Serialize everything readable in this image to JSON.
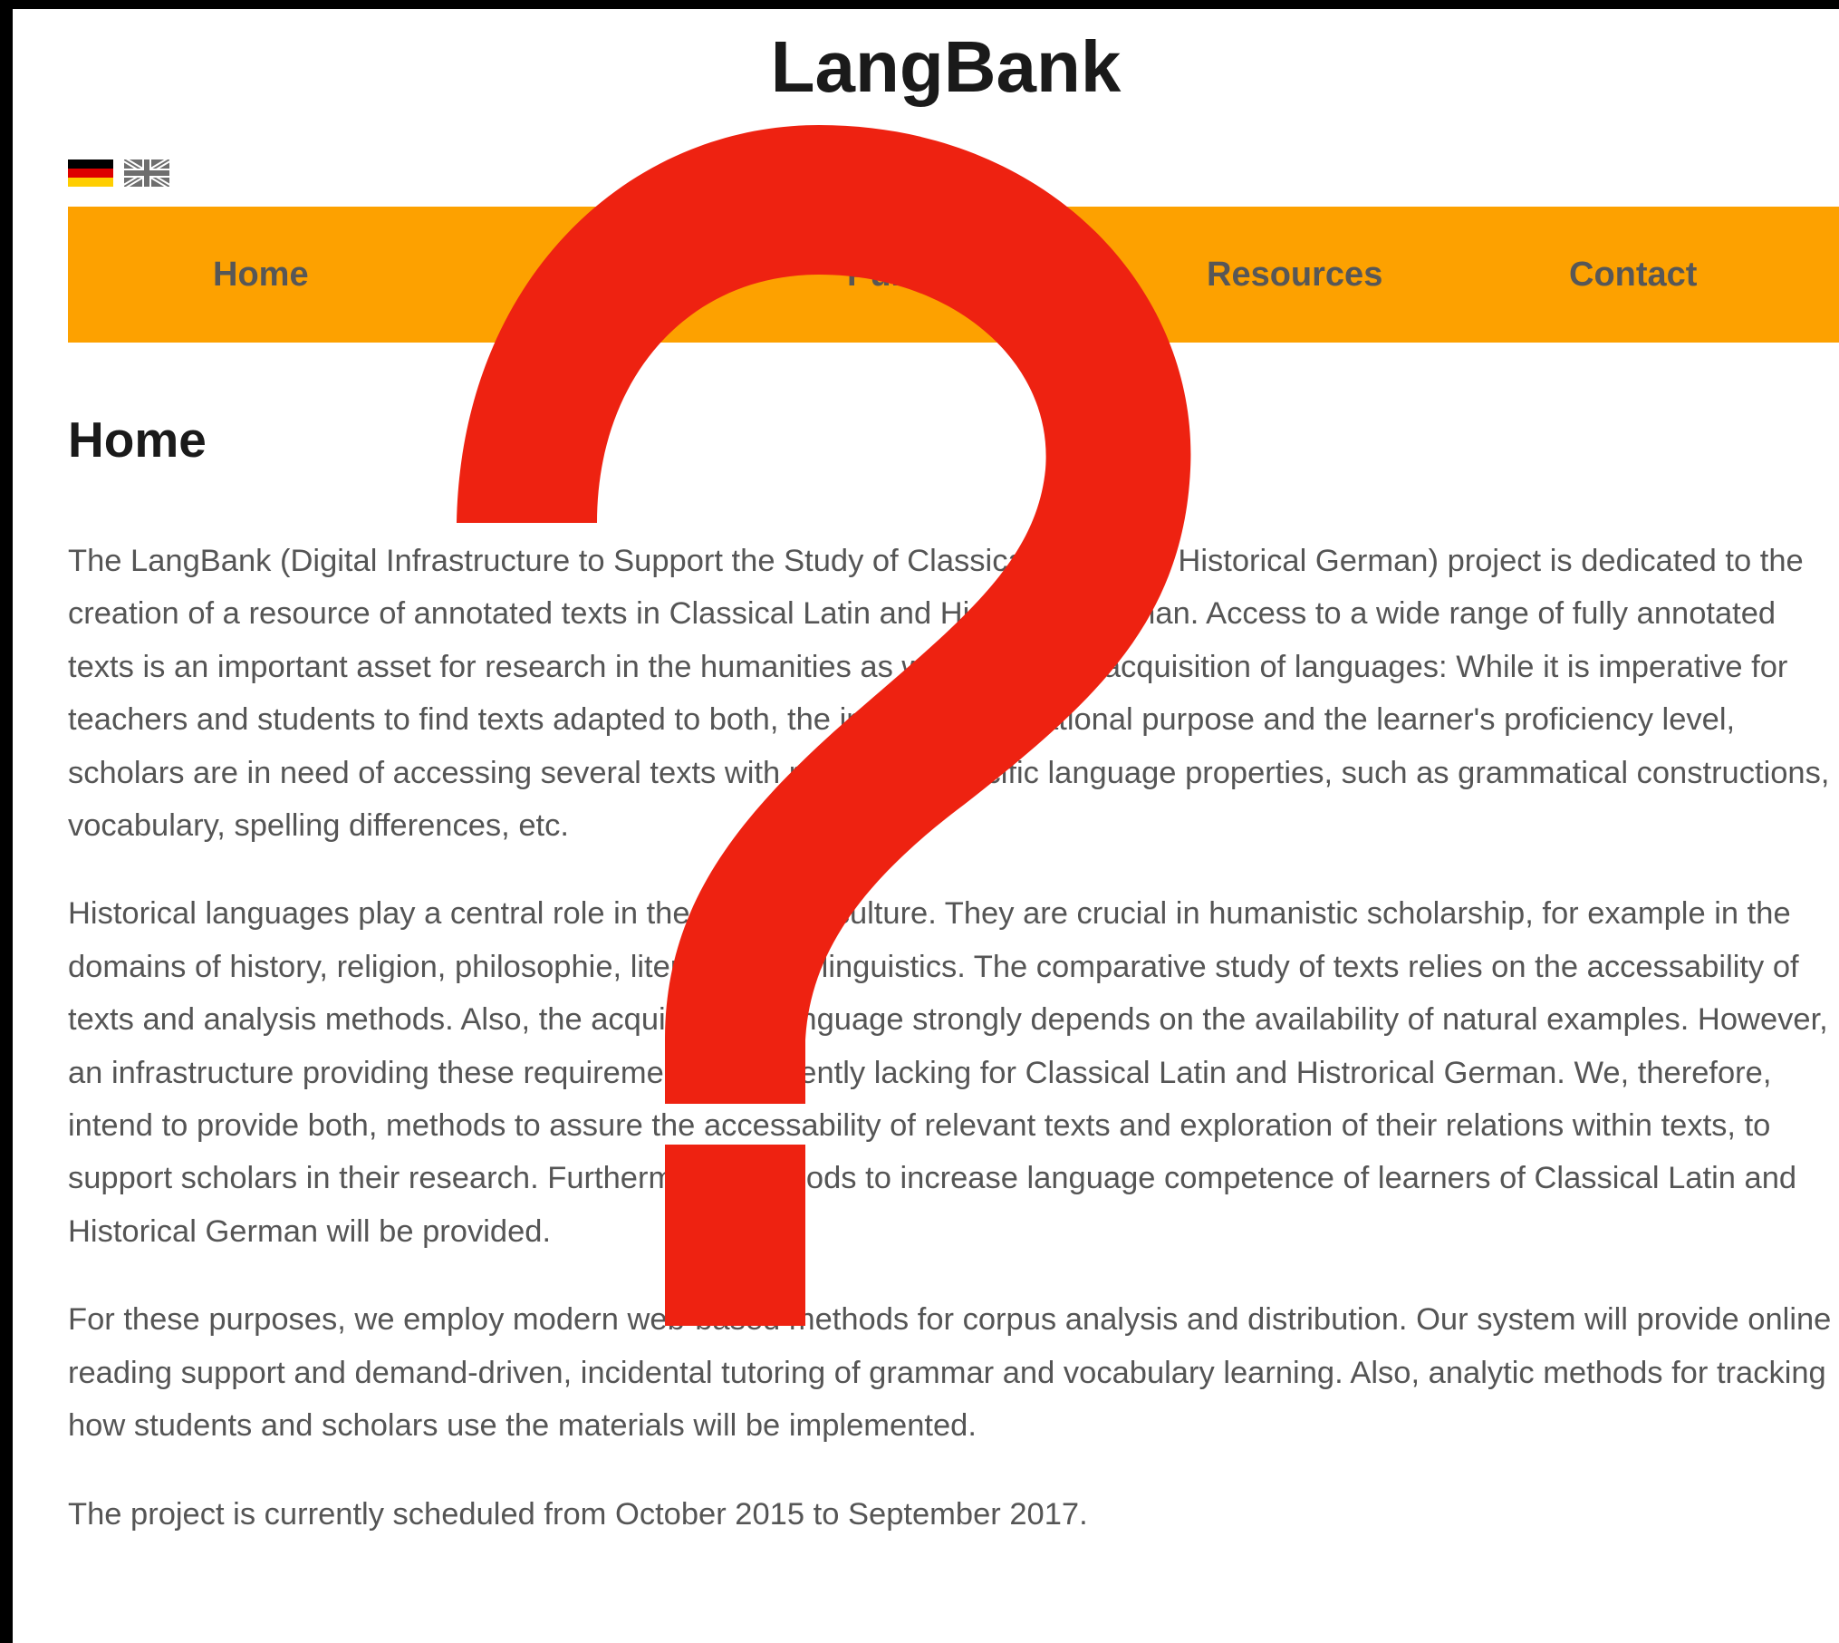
{
  "site": {
    "title": "LangBank"
  },
  "language_switcher": {
    "flags": [
      {
        "icon": "german-flag-icon",
        "colors": [
          "#000000",
          "#DD0000",
          "#FFCE00"
        ]
      },
      {
        "icon": "uk-flag-icon",
        "colors": [
          "#6e6e6e",
          "#ffffff"
        ]
      }
    ]
  },
  "nav": {
    "background": "#FDA100",
    "items": [
      {
        "label": "Home"
      },
      {
        "label": "Publica"
      },
      {
        "label": "Resources"
      },
      {
        "label": "Contact"
      }
    ]
  },
  "page": {
    "heading": "Home",
    "paragraphs": [
      "The LangBank (Digital Infrastructure to Support the Study of Classical Latin and Historical German) project is dedicated to the creation of a resource of annotated texts in Classical Latin and Histroical German. Access to a wide range of fully annotated texts is an important asset for research in the humanities as well as for the acquisition of languages: While it is imperative for teachers and students to find texts adapted to both, the intended illustrational purpose and the learner's proficiency level, scholars are in need of accessing several texts with respect to specific language properties, such as grammatical constructions, vocabulary, spelling differences, etc.",
      "Historical languages play a central role in the history of culture. They are crucial in humanistic scholarship, for example in the domains of history, religion, philosophie, literature and linguistics. The comparative study of texts relies on the accessability of texts and analysis methods. Also, the acquistion of language strongly depends on the availability of natural examples. However, an infrastructure providing these requirements is currently lacking for Classical Latin and Histrorical German. We, therefore, intend to provide both, methods to assure the accessability of relevant texts and exploration of their relations within texts, to support scholars in their research. Furthermore, methods to increase language competence of learners of Classical Latin and Historical German will be provided.",
      "For these purposes, we employ modern web-based methods for corpus analysis and distribution. Our system will provide online reading support and demand-driven, incidental tutoring of grammar and vocabulary learning. Also, analytic methods for tracking how students and scholars use the materials will be implemented.",
      "The project is currently scheduled from October 2015 to September 2017."
    ]
  },
  "overlay": {
    "icon": "question-mark-icon",
    "color": "#EE2211"
  }
}
